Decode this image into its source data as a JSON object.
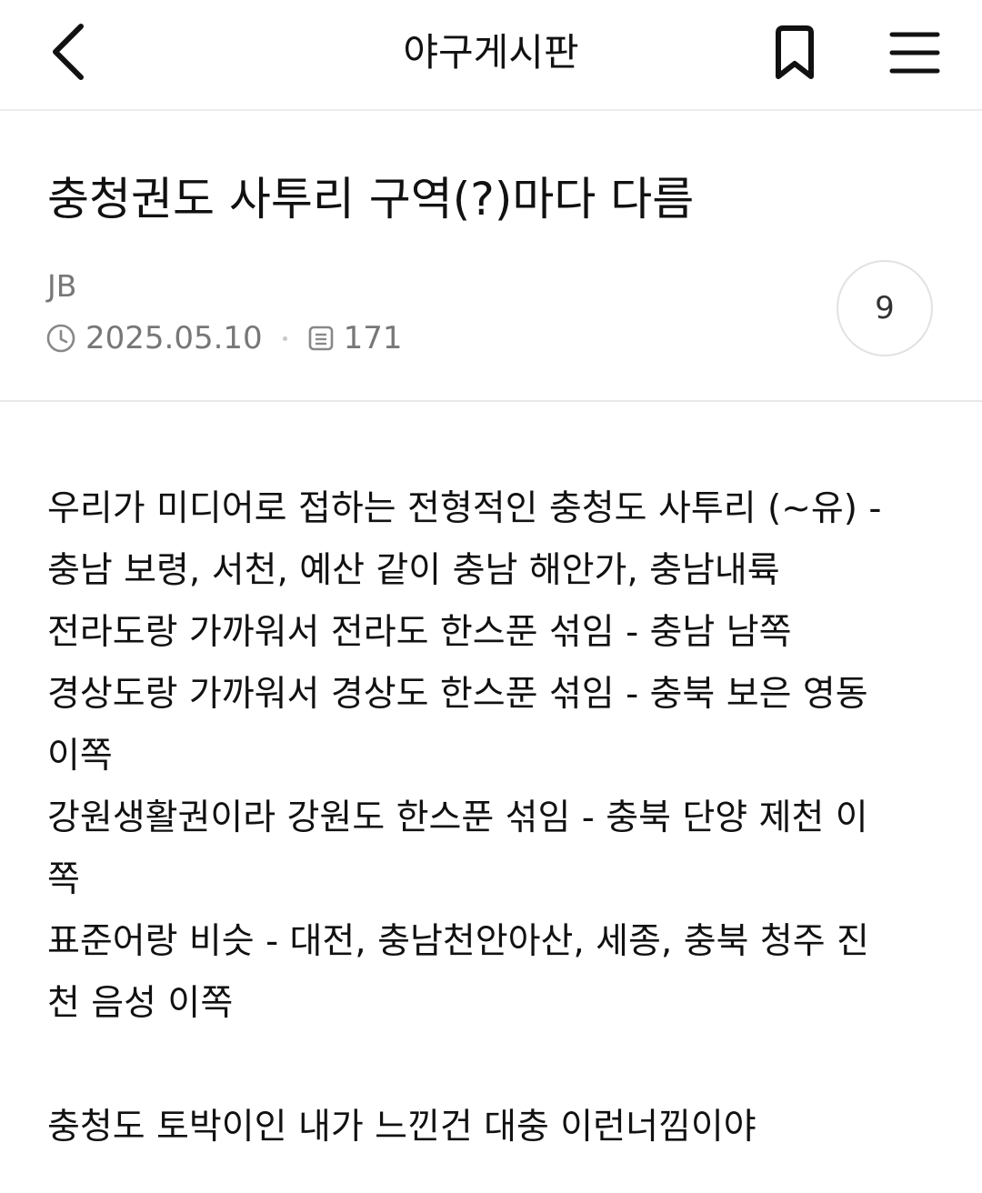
{
  "header": {
    "title": "야구게시판",
    "back_icon": "chevron-left-icon",
    "bookmark_icon": "bookmark-icon",
    "menu_icon": "hamburger-menu-icon"
  },
  "post": {
    "title": "충청권도 사투리 구역(?)마다 다름",
    "author": "JB",
    "date": "2025.05.10",
    "views": "171",
    "comment_count": "9",
    "body_lines": [
      "우리가 미디어로 접하는 전형적인 충청도 사투리 (~유) -",
      "충남 보령, 서천, 예산 같이 충남 해안가, 충남내륙",
      "전라도랑 가까워서 전라도 한스푼 섞임 - 충남 남쪽",
      "경상도랑 가까워서 경상도 한스푼 섞임 - 충북 보은 영동",
      "이쪽",
      "강원생활권이라 강원도 한스푼 섞임 - 충북 단양 제천 이",
      "쪽",
      "표준어랑 비슷 - 대전, 충남천안아산, 세종, 충북 청주 진",
      "천 음성 이쪽",
      "",
      "충청도 토박이인 내가 느낀건 대충 이런너낌이야"
    ]
  },
  "colors": {
    "text": "#111111",
    "muted": "#777777",
    "divider": "#e8e8e8"
  }
}
